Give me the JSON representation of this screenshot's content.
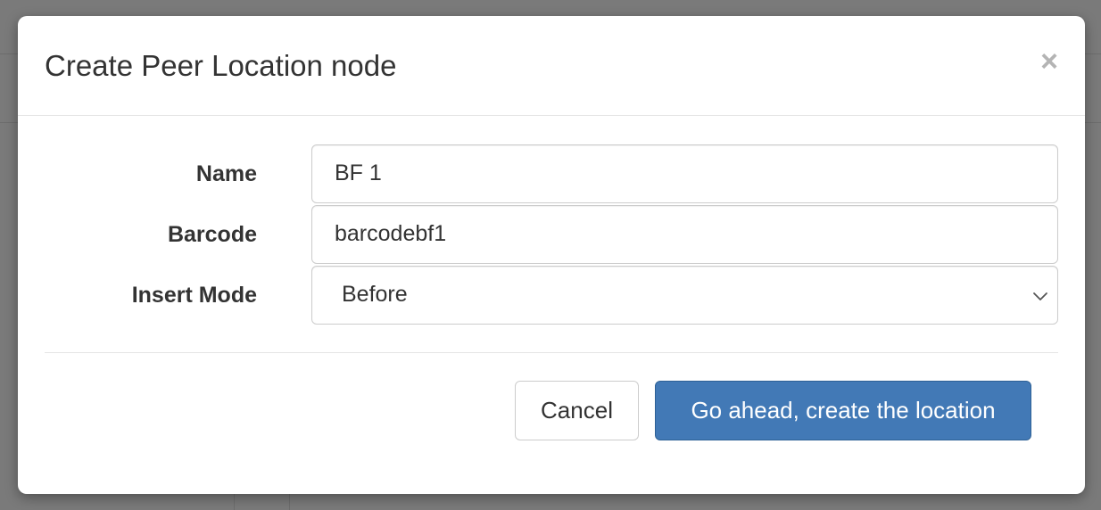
{
  "modal": {
    "title": "Create Peer Location node",
    "close_label": "×"
  },
  "form": {
    "name": {
      "label": "Name",
      "value": "BF 1"
    },
    "barcode": {
      "label": "Barcode",
      "value": "barcodebf1"
    },
    "insert_mode": {
      "label": "Insert Mode",
      "selected": "Before"
    }
  },
  "footer": {
    "cancel_label": "Cancel",
    "submit_label": "Go ahead, create the location"
  },
  "colors": {
    "primary": "#4279b6",
    "overlay": "#7a7a7a"
  },
  "icons": {
    "close": "close-icon",
    "select": "chevron-down-icon"
  }
}
